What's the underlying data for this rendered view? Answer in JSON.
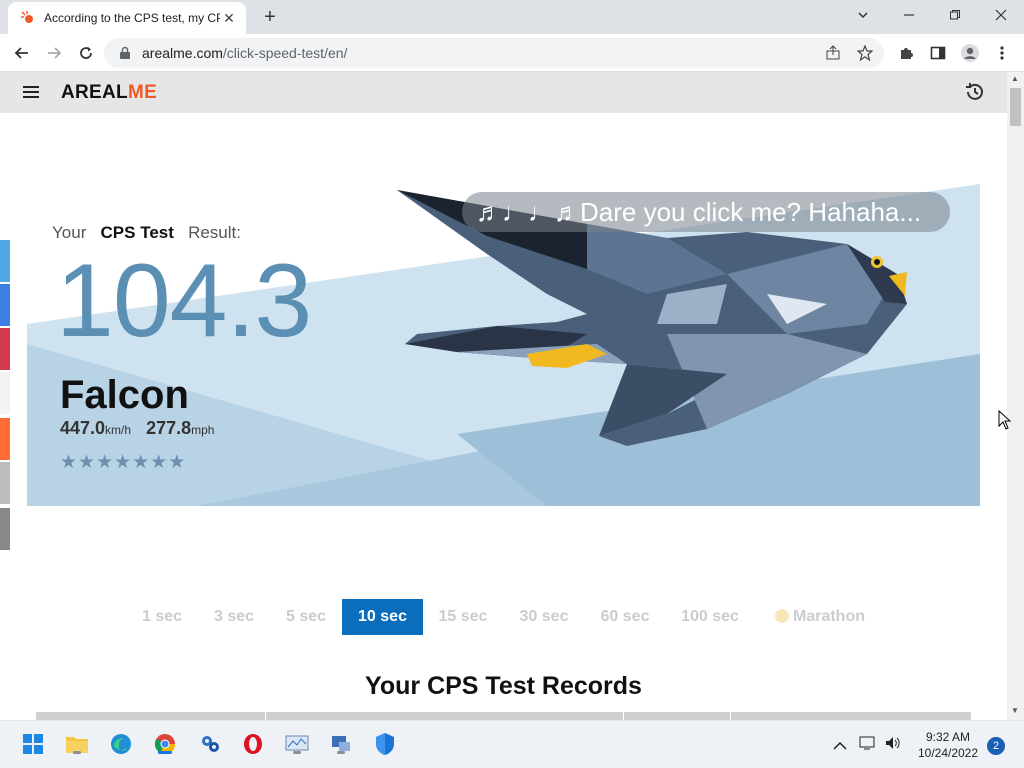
{
  "browser": {
    "tab_title": "According to the CPS test, my CP",
    "url_host": "arealme.com",
    "url_path": "/click-speed-test/en/"
  },
  "site": {
    "logo_part1": "AREAL",
    "logo_part2": "ME"
  },
  "result": {
    "your": "Your",
    "test_name": "CPS Test",
    "result_word": "Result:",
    "score": "104.3",
    "rank": "Falcon",
    "speed_kmh": "447.0",
    "unit_kmh": "km/h",
    "speed_mph": "277.8",
    "unit_mph": "mph",
    "stars": "★★★★★★★",
    "star_count": 7,
    "bubble_text": "♬♩♩♬Dare you click me? Hahaha..."
  },
  "time_options": [
    {
      "label": "1 sec",
      "active": false
    },
    {
      "label": "3 sec",
      "active": false
    },
    {
      "label": "5 sec",
      "active": false
    },
    {
      "label": "10 sec",
      "active": true
    },
    {
      "label": "15 sec",
      "active": false
    },
    {
      "label": "30 sec",
      "active": false
    },
    {
      "label": "60 sec",
      "active": false
    },
    {
      "label": "100 sec",
      "active": false
    },
    {
      "label": "Marathon",
      "active": false
    }
  ],
  "records_title": "Your CPS Test Records",
  "taskbar": {
    "time": "9:32 AM",
    "date": "10/24/2022",
    "notifications": "2"
  },
  "colors": {
    "accent": "#0a6ebd",
    "score": "#5b8fb4",
    "logo_me": "#ef5a28"
  },
  "icons": [
    "menu-icon",
    "history-icon",
    "lock-icon",
    "share-icon",
    "star-icon",
    "extensions-icon",
    "sidepanel-icon",
    "profile-icon",
    "more-icon"
  ]
}
